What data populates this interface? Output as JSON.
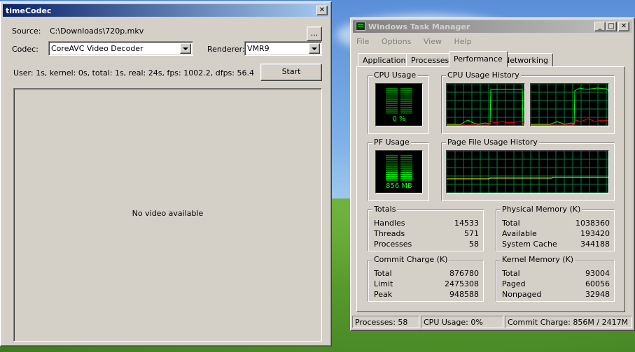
{
  "timecodec": {
    "title": "timeCodec",
    "source_label": "Source:",
    "source_value": "C:\\Downloads\\720p.mkv",
    "browse_label": "...",
    "codec_label": "Codec:",
    "codec_value": "CoreAVC Video Decoder",
    "renderer_label": "Renderer:",
    "renderer_value": "VMR9",
    "stats": "User: 1s, kernel: 0s, total: 1s, real: 24s, fps: 1002.2, dfps: 56.4",
    "start_label": "Start",
    "video_message": "No video available"
  },
  "taskmgr": {
    "title": "Windows Task Manager",
    "menu": [
      "File",
      "Options",
      "View",
      "Help"
    ],
    "tabs": [
      "Applications",
      "Processes",
      "Performance",
      "Networking"
    ],
    "selected_tab": "Performance",
    "cpu_usage_label": "CPU Usage",
    "cpu_usage_value": "0 %",
    "cpu_usage_level": 0.0,
    "cpu_history_label": "CPU Usage History",
    "pf_usage_label": "PF Usage",
    "pf_usage_value": "856 MB",
    "pf_usage_level": 0.35,
    "pf_history_label": "Page File Usage History",
    "totals": {
      "label": "Totals",
      "rows": [
        {
          "name": "Handles",
          "value": "14533"
        },
        {
          "name": "Threads",
          "value": "571"
        },
        {
          "name": "Processes",
          "value": "58"
        }
      ]
    },
    "physical": {
      "label": "Physical Memory (K)",
      "rows": [
        {
          "name": "Total",
          "value": "1038360"
        },
        {
          "name": "Available",
          "value": "193420"
        },
        {
          "name": "System Cache",
          "value": "344188"
        }
      ]
    },
    "commit": {
      "label": "Commit Charge (K)",
      "rows": [
        {
          "name": "Total",
          "value": "876780"
        },
        {
          "name": "Limit",
          "value": "2475308"
        },
        {
          "name": "Peak",
          "value": "948588"
        }
      ]
    },
    "kernel": {
      "label": "Kernel Memory (K)",
      "rows": [
        {
          "name": "Total",
          "value": "93004"
        },
        {
          "name": "Paged",
          "value": "60056"
        },
        {
          "name": "Nonpaged",
          "value": "32948"
        }
      ]
    },
    "status": {
      "processes": "Processes: 58",
      "cpu": "CPU Usage: 0%",
      "commit": "Commit Charge: 856M / 2417M"
    }
  },
  "colors": {
    "graph_green": "#00ff00",
    "graph_red": "#ff0000",
    "grid": "#008040",
    "title_active": "#0a246a"
  }
}
